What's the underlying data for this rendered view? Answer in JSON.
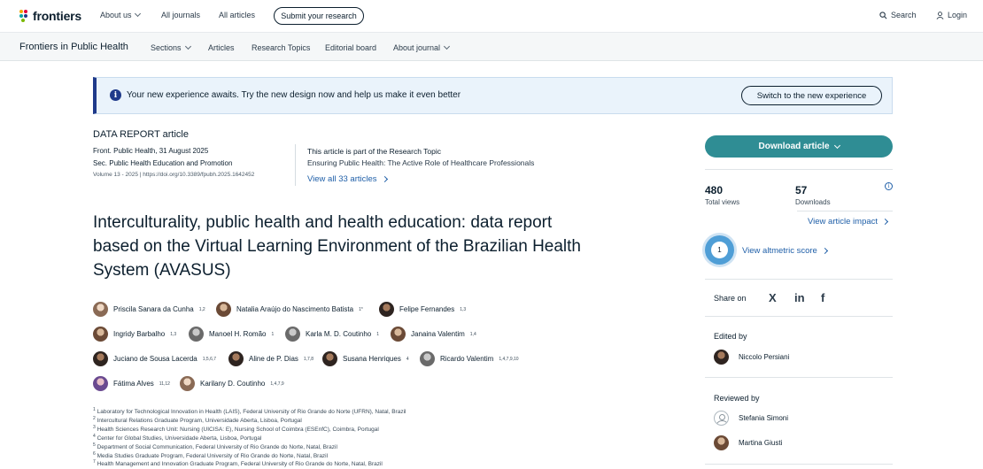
{
  "topnav": {
    "logo": "frontiers",
    "about": "About us",
    "all_journals": "All journals",
    "all_articles": "All articles",
    "submit": "Submit your research",
    "search": "Search",
    "login": "Login"
  },
  "subnav": {
    "journal": "Frontiers in Public Health",
    "sections": "Sections",
    "articles": "Articles",
    "research_topics": "Research Topics",
    "editorial_board": "Editorial board",
    "about_journal": "About journal"
  },
  "banner": {
    "text": "Your new experience awaits. Try the new design now and help us make it even better",
    "button": "Switch to the new experience"
  },
  "article": {
    "type": "DATA REPORT article",
    "journal_date": "Front. Public Health, 31 August 2025",
    "section": "Sec. Public Health Education and Promotion",
    "volume_doi": "Volume 13 - 2025 | https://doi.org/10.3389/fpubh.2025.1642452",
    "topic_label": "This article is part of the Research Topic",
    "topic_title": "Ensuring Public Health: The Active Role of Healthcare Professionals",
    "view_all": "View all 33 articles",
    "title": "Interculturality, public health and health education: data report based on the Virtual Learning Environment of the Brazilian Health System (AVASUS)"
  },
  "authors": [
    {
      "name": "Priscila Sanara da Cunha",
      "sup": "1,2"
    },
    {
      "name": "Natalia Araújo do Nascimento Batista",
      "sup": "1*"
    },
    {
      "name": "Felipe Fernandes",
      "sup": "1,3"
    },
    {
      "name": "Ingridy Barbalho",
      "sup": "1,3"
    },
    {
      "name": "Manoel H. Romão",
      "sup": "1"
    },
    {
      "name": "Karla M. D. Coutinho",
      "sup": "1"
    },
    {
      "name": "Janaina Valentim",
      "sup": "1,4"
    },
    {
      "name": "Juciano de Sousa Lacerda",
      "sup": "1,5,6,7"
    },
    {
      "name": "Aline de P. Dias",
      "sup": "1,7,8"
    },
    {
      "name": "Susana Henriques",
      "sup": "4"
    },
    {
      "name": "Ricardo Valentim",
      "sup": "1,4,7,9,10"
    },
    {
      "name": "Fátima Alves",
      "sup": "11,12"
    },
    {
      "name": "Karilany D. Coutinho",
      "sup": "1,4,7,9"
    }
  ],
  "affiliations": [
    {
      "n": "1",
      "text": "Laboratory for Technological Innovation in Health (LAIS), Federal University of Rio Grande do Norte (UFRN), Natal, Brazil"
    },
    {
      "n": "2",
      "text": "Intercultural Relations Graduate Program, Universidade Aberta, Lisboa, Portugal"
    },
    {
      "n": "3",
      "text": "Health Sciences Research Unit: Nursing (UICISA: E), Nursing School of Coimbra (ESEnfC), Coimbra, Portugal"
    },
    {
      "n": "4",
      "text": "Center for Global Studies, Universidade Aberta, Lisboa, Portugal"
    },
    {
      "n": "5",
      "text": "Department of Social Communication, Federal University of Rio Grande do Norte, Natal, Brazil"
    },
    {
      "n": "6",
      "text": "Media Studies Graduate Program, Federal University of Rio Grande do Norte, Natal, Brazil"
    },
    {
      "n": "7",
      "text": "Health Management and Innovation Graduate Program, Federal University of Rio Grande do Norte, Natal, Brazil"
    }
  ],
  "sidebar": {
    "download": "Download article",
    "views_num": "480",
    "views_lbl": "Total views",
    "downloads_num": "57",
    "downloads_lbl": "Downloads",
    "impact": "View article impact",
    "altmetric_score": "1",
    "altmetric": "View altmetric score",
    "share_on": "Share on",
    "share_x": "X",
    "share_in": "in",
    "share_fb": "f",
    "edited_by": "Edited by",
    "editor": "Niccolo Persiani",
    "reviewed_by": "Reviewed by",
    "reviewer1": "Stefania Simoni",
    "reviewer2": "Martina Giusti"
  },
  "colors": {
    "accent": "#2f8d94",
    "link": "#1f5fa8",
    "banner_bg": "#eaf3fb",
    "banner_border": "#1f3a8a"
  },
  "icons": [
    "frontiers-logo-icon",
    "chevron-down-icon",
    "search-icon",
    "user-icon",
    "info-icon",
    "chevron-right-icon",
    "x-twitter-icon",
    "linkedin-icon",
    "facebook-icon"
  ]
}
